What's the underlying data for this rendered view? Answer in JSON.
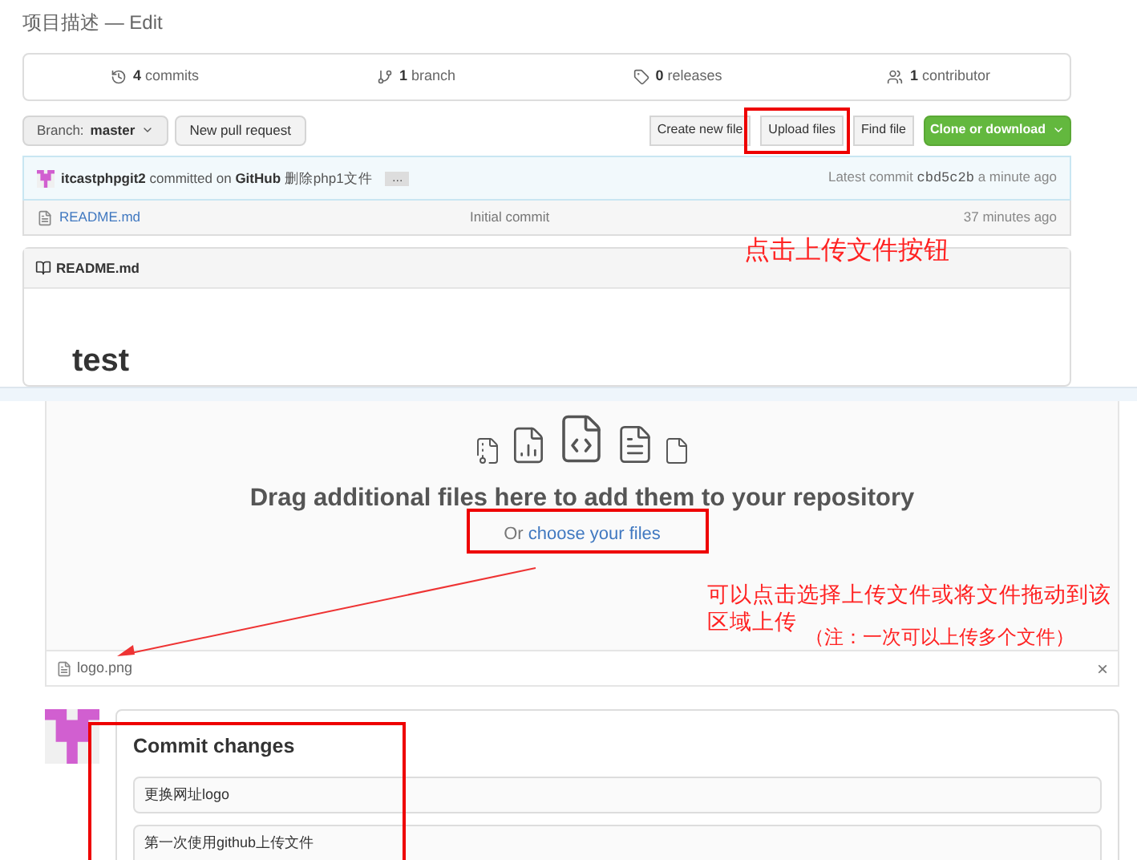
{
  "page_title": "项目描述 — Edit",
  "stats": [
    {
      "kind": "commits",
      "count": "4",
      "label": "commits"
    },
    {
      "kind": "branch",
      "count": "1",
      "label": "branch"
    },
    {
      "kind": "releases",
      "count": "0",
      "label": "releases"
    },
    {
      "kind": "contributors",
      "count": "1",
      "label": "contributor"
    }
  ],
  "branch_select": {
    "label": "Branch:",
    "value": "master"
  },
  "left_buttons": [
    "New pull request"
  ],
  "right_buttons": [
    {
      "label": "Create new file",
      "kind": "plain"
    },
    {
      "label": "Upload files",
      "kind": "plain"
    },
    {
      "label": "Find file",
      "kind": "plain"
    },
    {
      "label": "Clone or download",
      "kind": "primary"
    }
  ],
  "latest_commit": {
    "author": "itcastphpgit2",
    "action": "committed on",
    "site": "GitHub",
    "message": "删除php1文件",
    "more": "…",
    "prefix": "Latest commit",
    "sha": "cbd5c2b",
    "time": "a minute ago"
  },
  "files": [
    {
      "name": "README.md",
      "message": "Initial commit",
      "time": "37 minutes ago"
    }
  ],
  "readme": {
    "filename": "README.md",
    "heading": "test"
  },
  "upload": {
    "heading": "Drag additional files here to add them to your repository",
    "or": "Or",
    "choose": "choose your files"
  },
  "queued_files": [
    {
      "name": "logo.png",
      "remove": "×"
    }
  ],
  "commit_form": {
    "title": "Commit changes",
    "summary": "更换网址logo",
    "description": "第一次使用github上传文件"
  },
  "annotations": [
    {
      "kind": "note",
      "text": "点击上传文件按钮"
    },
    {
      "kind": "note",
      "text": "可以点击选择上传文件或将文件拖动到该区域上传"
    },
    {
      "kind": "note",
      "text": "（注：一次可以上传多个文件）"
    }
  ]
}
